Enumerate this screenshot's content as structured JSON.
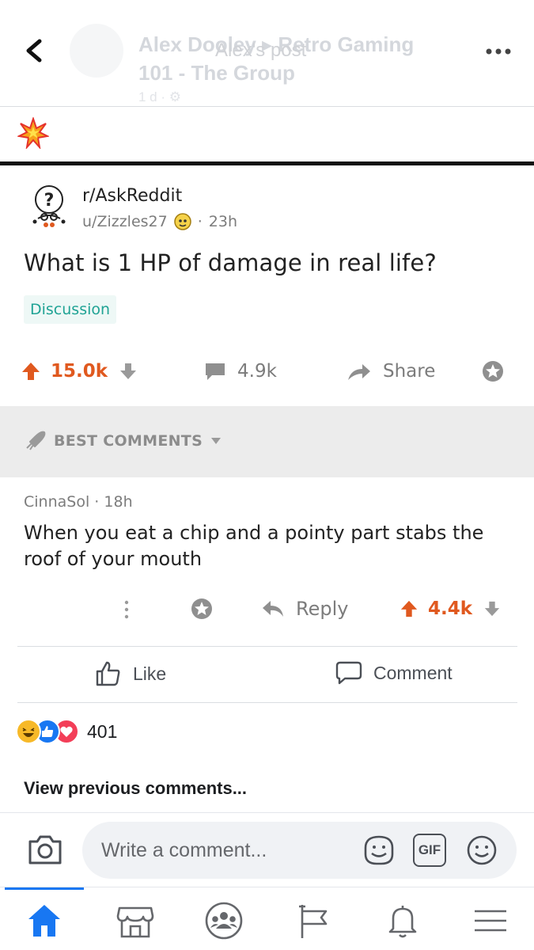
{
  "header": {
    "title": "Alex Dooley ▸ Retro Gaming 101 - The Group",
    "subtitle": "Alex's post",
    "meta": "1 d · ⚙"
  },
  "post": {
    "emoji": "💥"
  },
  "reddit": {
    "subreddit": "r/AskReddit",
    "user": "u/Zizzles27",
    "time": "23h",
    "title": "What is 1 HP of damage in real life?",
    "flair": "Discussion",
    "upvotes": "15.0k",
    "comments": "4.9k",
    "share_label": "Share",
    "best_comments_label": "BEST COMMENTS",
    "comment": {
      "author": "CinnaSol",
      "time": "18h",
      "text": "When you eat a chip and a pointy part stabs the roof of your mouth",
      "reply_label": "Reply",
      "votes": "4.4k"
    }
  },
  "fb": {
    "like_label": "Like",
    "comment_label": "Comment",
    "reaction_count": "401",
    "view_previous": "View previous comments...",
    "input_placeholder": "Write a comment...",
    "gif_label": "GIF"
  },
  "colors": {
    "reddit_orange": "#e0591f",
    "fb_blue": "#1877f2",
    "flair_teal": "#20a395"
  }
}
